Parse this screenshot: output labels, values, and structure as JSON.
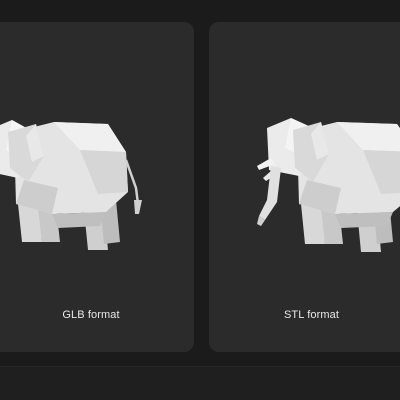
{
  "cards": [
    {
      "label": "GLB format",
      "icon": "elephant-model-icon"
    },
    {
      "label": "STL format",
      "icon": "elephant-model-icon"
    }
  ],
  "colors": {
    "background": "#1b1b1b",
    "card": "#2b2b2b",
    "label": "#e8e8e8",
    "model": "#e6e6e6"
  }
}
